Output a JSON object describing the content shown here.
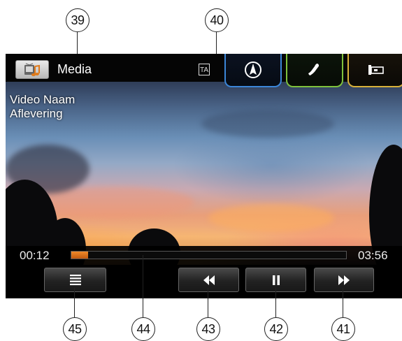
{
  "callouts": {
    "top_left": "39",
    "top_right": "40",
    "list": "45",
    "progress": "44",
    "rewind": "43",
    "pause": "42",
    "forward": "41"
  },
  "topbar": {
    "title": "Media",
    "ta_label": "TA",
    "source_icon": "media-source-icon",
    "tabs": [
      {
        "name": "navigation",
        "icon": "navigation-icon",
        "color": "#3b86d8"
      },
      {
        "name": "phone",
        "icon": "phone-icon",
        "color": "#7fc23c"
      },
      {
        "name": "settings",
        "icon": "vehicle-settings-icon",
        "color": "#d8b13a"
      }
    ]
  },
  "video": {
    "name": "Video Naam",
    "episode": "Aflevering"
  },
  "playback": {
    "current_time": "00:12",
    "total_time": "03:56",
    "progress_fraction": 0.06,
    "progress_color": "#f08a2a"
  },
  "controls": {
    "list": "list-icon",
    "rewind": "rewind-icon",
    "pause": "pause-icon",
    "forward": "fast-forward-icon"
  }
}
